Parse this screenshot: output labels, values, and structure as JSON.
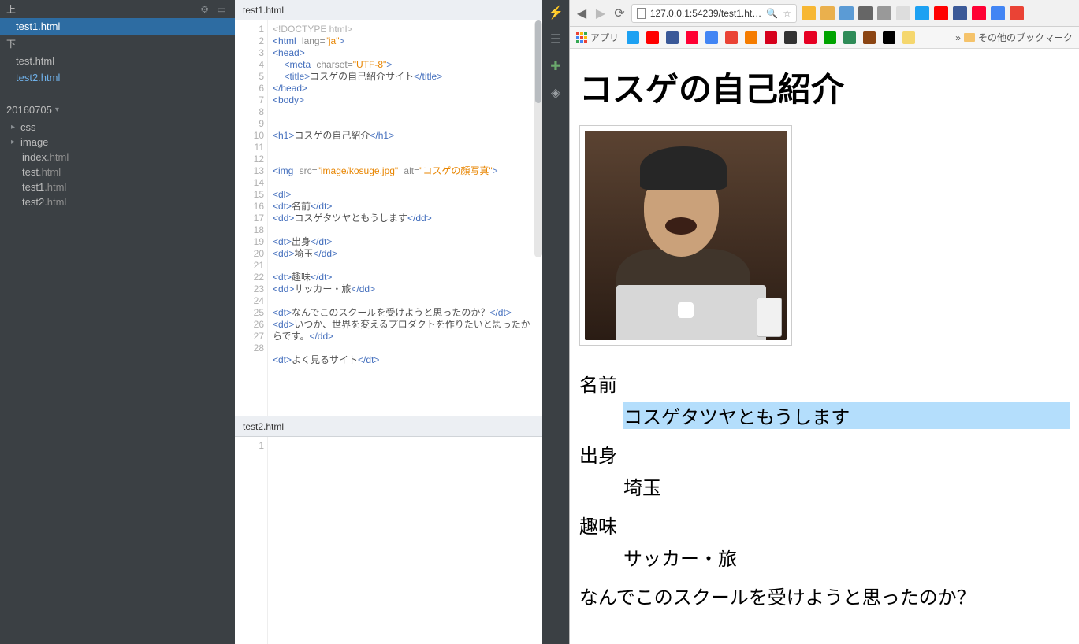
{
  "sidebar": {
    "top_label": "上",
    "bottom_label": "下",
    "working_top": [
      "test1.html"
    ],
    "working_bottom": [
      "test.html",
      "test2.html"
    ],
    "project_name": "20160705",
    "tree": [
      {
        "name": "css",
        "folder": true
      },
      {
        "name": "image",
        "folder": true
      },
      {
        "name": "index",
        "ext": ".html"
      },
      {
        "name": "test",
        "ext": ".html"
      },
      {
        "name": "test1",
        "ext": ".html"
      },
      {
        "name": "test2",
        "ext": ".html"
      }
    ]
  },
  "editor": {
    "tab_top": "test1.html",
    "tab_bottom": "test2.html",
    "code": {
      "doctype": "<!DOCTYPE html>",
      "html_open": "<html lang=\"ja\">",
      "head_open": "<head>",
      "meta": "<meta charset=\"UTF-8\">",
      "title_open": "<title>",
      "title_text": "コスゲの自己紹介サイト",
      "title_close": "</title>",
      "head_close": "</head>",
      "body_open": "<body>",
      "h1_open": "<h1>",
      "h1_text": "コスゲの自己紹介",
      "h1_close": "</h1>",
      "img": "<img src=\"image/kosuge.jpg\" alt=\"コスゲの顔写真\">",
      "dl_open": "<dl>",
      "dt1": "<dt>名前</dt>",
      "dd1": "<dd>コスゲタツヤともうします</dd>",
      "dt2": "<dt>出身</dt>",
      "dd2": "<dd>埼玉</dd>",
      "dt3": "<dt>趣味</dt>",
      "dd3": "<dd>サッカー・旅</dd>",
      "dt4": "<dt>なんでこのスクールを受けようと思ったのか？</dt>",
      "dd4": "<dd>いつか、世界を変えるプロダクトを作りたいと思ったからです。</dd>",
      "dt5": "<dt>よく見るサイト</dt>"
    },
    "line_numbers": [
      "1",
      "2",
      "3",
      "4",
      "5",
      "6",
      "7",
      "8",
      "9",
      "10",
      "11",
      "12",
      "13",
      "",
      "14",
      "15",
      "16",
      "17",
      "18",
      "19",
      "20",
      "21",
      "22",
      "23",
      "24",
      "25",
      "",
      "26",
      "",
      "27",
      "28"
    ],
    "bottom_line": "1"
  },
  "browser": {
    "url": "127.0.0.1:54239/test1.ht…",
    "apps_label": "アプリ",
    "other_bookmarks": "その他のブックマーク",
    "other_more": "»",
    "ext_colors": [
      "#f7b733",
      "#eab04d",
      "#5b9bd5",
      "#666",
      "#999",
      "#ddd",
      "#1da1f2",
      "#ff0000",
      "#3b5998",
      "#ff0033",
      "#4285f4",
      "#ea4335",
      "#f57c00",
      "#d6001c",
      "#333",
      "#e60023",
      "#00a300",
      "#2e8b57",
      "#8b4513",
      "#000",
      "#f5d76e"
    ],
    "bm_colors": [
      "#1da1f2",
      "#ff0000",
      "#3b5998",
      "#ff0033",
      "#4285f4",
      "#ea4335",
      "#f57c00",
      "#d6001c",
      "#333",
      "#e60023",
      "#00a300",
      "#2e8b57",
      "#8b4513",
      "#000",
      "#f5d76e"
    ]
  },
  "page": {
    "h1": "コスゲの自己紹介",
    "dt1": "名前",
    "dd1": "コスゲタツヤともうします",
    "dt2": "出身",
    "dd2": "埼玉",
    "dt3": "趣味",
    "dd3": "サッカー・旅",
    "dt4": "なんでこのスクールを受けようと思ったのか？"
  }
}
